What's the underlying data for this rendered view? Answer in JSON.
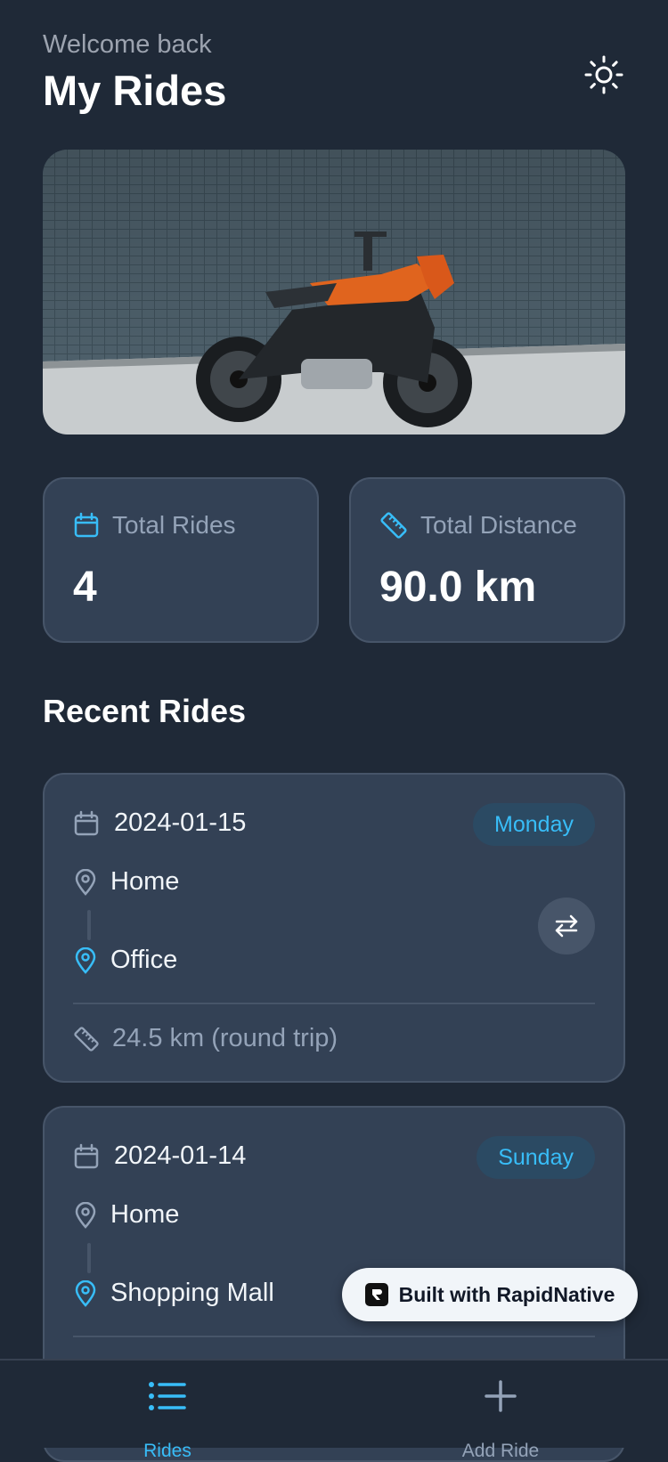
{
  "header": {
    "welcome": "Welcome back",
    "title": "My Rides",
    "theme_icon": "sun-icon"
  },
  "hero": {
    "image_icon": "motorcycle-photo"
  },
  "stats": [
    {
      "label": "Total Rides",
      "value": "4",
      "icon": "calendar-icon"
    },
    {
      "label": "Total Distance",
      "value": "90.0 km",
      "icon": "ruler-icon"
    }
  ],
  "recent": {
    "title": "Recent Rides"
  },
  "rides": [
    {
      "date": "2024-01-15",
      "day": "Monday",
      "from": "Home",
      "to": "Office",
      "distance": "24.5 km (round trip)"
    },
    {
      "date": "2024-01-14",
      "day": "Sunday",
      "from": "Home",
      "to": "Shopping Mall"
    }
  ],
  "built_badge": {
    "label": "Built with RapidNative"
  },
  "tabbar": {
    "tabs": [
      {
        "label": "Rides",
        "icon": "list-icon",
        "active": true
      },
      {
        "label": "Add Ride",
        "icon": "plus-icon",
        "active": false
      }
    ]
  },
  "colors": {
    "background": "#1f2937",
    "card": "#334155",
    "accent": "#38bdf8",
    "muted": "#94a3b8"
  }
}
